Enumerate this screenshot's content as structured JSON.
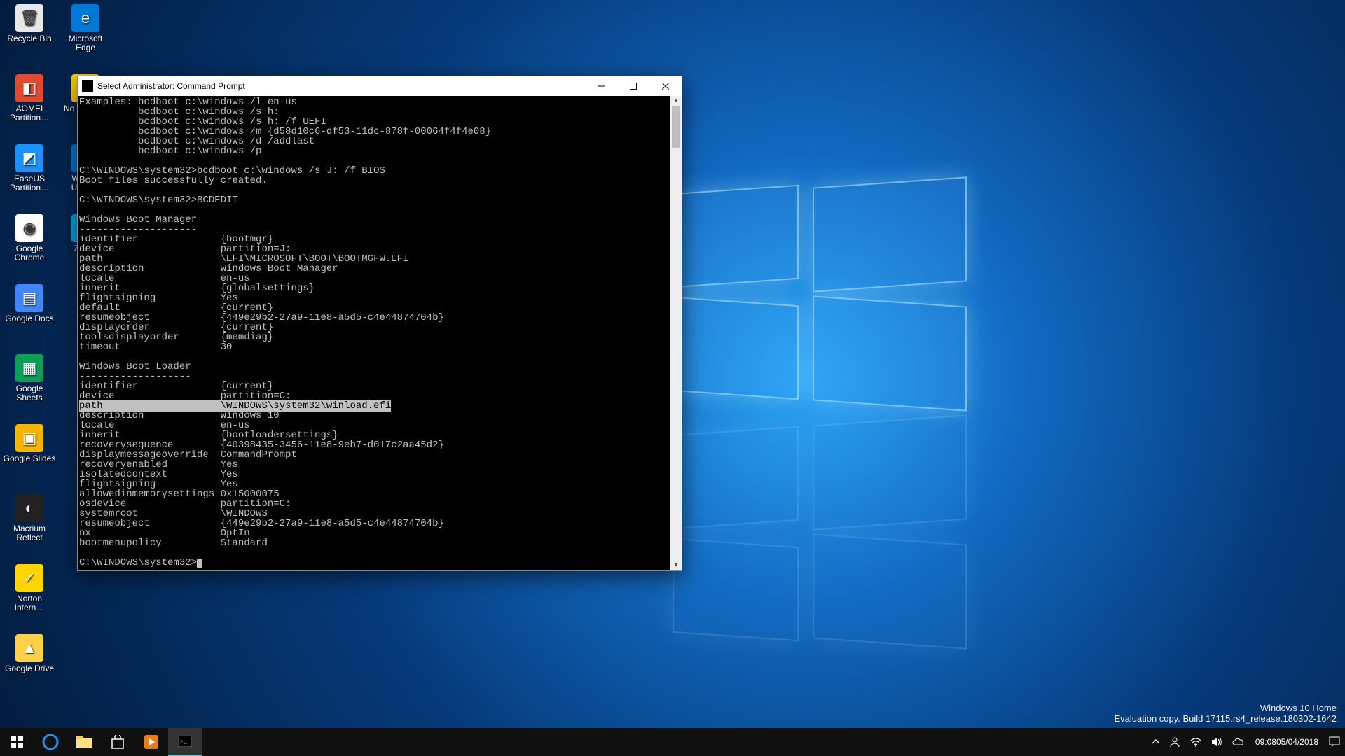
{
  "desktop_icons_col1": [
    {
      "name": "recycle-bin",
      "label": "Recycle Bin",
      "fill": "#e8e8e8",
      "glyph": "🗑"
    },
    {
      "name": "aomei",
      "label": "AOMEI Partition…",
      "fill": "#e04b2f",
      "glyph": "◧"
    },
    {
      "name": "easeus",
      "label": "EaseUS Partition…",
      "fill": "#1e90ff",
      "glyph": "◩"
    },
    {
      "name": "chrome",
      "label": "Google Chrome",
      "fill": "#ffffff",
      "glyph": "◉"
    },
    {
      "name": "gdocs",
      "label": "Google Docs",
      "fill": "#4285f4",
      "glyph": "▤"
    },
    {
      "name": "gsheets",
      "label": "Google Sheets",
      "fill": "#0f9d58",
      "glyph": "▦"
    },
    {
      "name": "gslides",
      "label": "Google Slides",
      "fill": "#f4b400",
      "glyph": "▣"
    },
    {
      "name": "macrium",
      "label": "Macrium Reflect",
      "fill": "#222",
      "glyph": "◐"
    },
    {
      "name": "norton",
      "label": "Norton Intern…",
      "fill": "#ffd400",
      "glyph": "✓"
    },
    {
      "name": "gdrive",
      "label": "Google Drive",
      "fill": "#ffd04b",
      "glyph": "▲"
    }
  ],
  "desktop_icons_col2": [
    {
      "name": "edge",
      "label": "Microsoft Edge",
      "fill": "#0078d7",
      "glyph": "e"
    },
    {
      "name": "norton-install",
      "label": "No… Inst…",
      "fill": "#ffd400",
      "glyph": "✓"
    },
    {
      "name": "winupdate",
      "label": "Wind… Upda…",
      "fill": "#0078d7",
      "glyph": "⚙"
    },
    {
      "name": "zen",
      "label": "Zen…",
      "fill": "#00a9e0",
      "glyph": "◎"
    }
  ],
  "cmd": {
    "title": "Select Administrator: Command Prompt",
    "lines": [
      "Examples: bcdboot c:\\windows /l en-us",
      "          bcdboot c:\\windows /s h:",
      "          bcdboot c:\\windows /s h: /f UEFI",
      "          bcdboot c:\\windows /m {d58d10c6-df53-11dc-878f-00064f4f4e08}",
      "          bcdboot c:\\windows /d /addlast",
      "          bcdboot c:\\windows /p",
      "",
      "C:\\WINDOWS\\system32>bcdboot c:\\windows /s J: /f BIOS",
      "Boot files successfully created.",
      "",
      "C:\\WINDOWS\\system32>BCDEDIT",
      "",
      "Windows Boot Manager",
      "--------------------",
      "identifier              {bootmgr}",
      "device                  partition=J:",
      "path                    \\EFI\\MICROSOFT\\BOOT\\BOOTMGFW.EFI",
      "description             Windows Boot Manager",
      "locale                  en-us",
      "inherit                 {globalsettings}",
      "flightsigning           Yes",
      "default                 {current}",
      "resumeobject            {449e29b2-27a9-11e8-a5d5-c4e44874704b}",
      "displayorder            {current}",
      "toolsdisplayorder       {memdiag}",
      "timeout                 30",
      "",
      "Windows Boot Loader",
      "-------------------",
      "identifier              {current}",
      "device                  partition=C:"
    ],
    "hl_line": "path                    \\WINDOWS\\system32\\winload.efi",
    "lines2": [
      "description             Windows 10",
      "locale                  en-us",
      "inherit                 {bootloadersettings}",
      "recoverysequence        {40398435-3456-11e8-9eb7-d017c2aa45d2}",
      "displaymessageoverride  CommandPrompt",
      "recoveryenabled         Yes",
      "isolatedcontext         Yes",
      "flightsigning           Yes",
      "allowedinmemorysettings 0x15000075",
      "osdevice                partition=C:",
      "systemroot              \\WINDOWS",
      "resumeobject            {449e29b2-27a9-11e8-a5d5-c4e44874704b}",
      "nx                      OptIn",
      "bootmenupolicy          Standard",
      "",
      "C:\\WINDOWS\\system32>"
    ]
  },
  "watermark": {
    "l1": "Windows 10 Home",
    "l2": "Evaluation copy. Build 17115.rs4_release.180302-1642"
  },
  "tray": {
    "time": "09:08",
    "date": "05/04/2018"
  }
}
